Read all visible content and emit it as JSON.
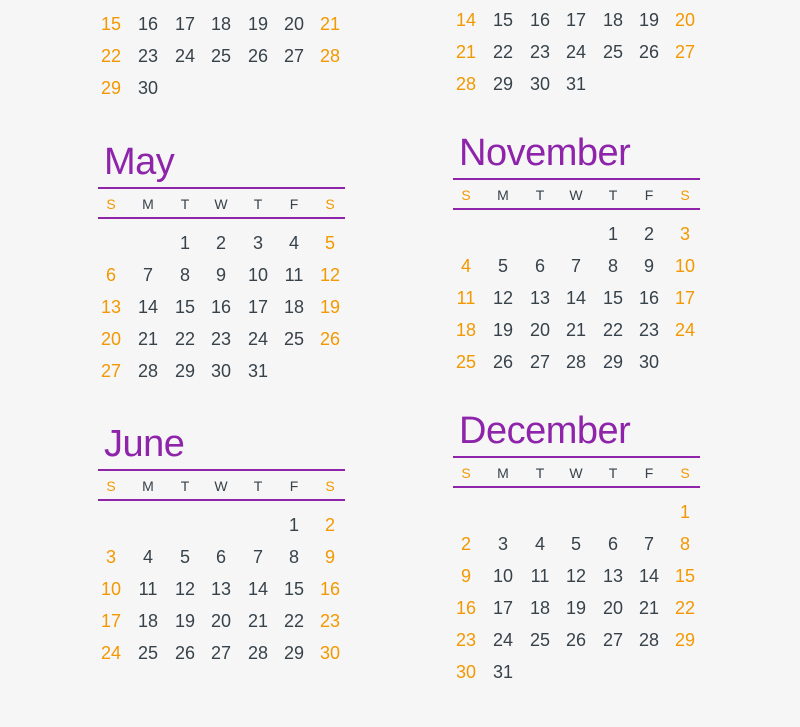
{
  "colors": {
    "title": "#8e24aa",
    "weekend": "#f39800",
    "text": "#37424a"
  },
  "weekday_headers": [
    "S",
    "M",
    "T",
    "W",
    "T",
    "F",
    "S"
  ],
  "calendars": [
    {
      "id": "partial-left",
      "title": "",
      "weeks": [
        [
          15,
          16,
          17,
          18,
          19,
          20,
          21
        ],
        [
          22,
          23,
          24,
          25,
          26,
          27,
          28
        ],
        [
          29,
          30,
          null,
          null,
          null,
          null,
          null
        ]
      ]
    },
    {
      "id": "partial-right",
      "title": "",
      "weeks": [
        [
          14,
          15,
          16,
          17,
          18,
          19,
          20
        ],
        [
          21,
          22,
          23,
          24,
          25,
          26,
          27
        ],
        [
          28,
          29,
          30,
          31,
          null,
          null,
          null
        ]
      ]
    },
    {
      "id": "may",
      "title": "May",
      "weeks": [
        [
          null,
          null,
          1,
          2,
          3,
          4,
          5
        ],
        [
          6,
          7,
          8,
          9,
          10,
          11,
          12
        ],
        [
          13,
          14,
          15,
          16,
          17,
          18,
          19
        ],
        [
          20,
          21,
          22,
          23,
          24,
          25,
          26
        ],
        [
          27,
          28,
          29,
          30,
          31,
          null,
          null
        ]
      ]
    },
    {
      "id": "november",
      "title": "November",
      "weeks": [
        [
          null,
          null,
          null,
          null,
          1,
          2,
          3
        ],
        [
          4,
          5,
          6,
          7,
          8,
          9,
          10
        ],
        [
          11,
          12,
          13,
          14,
          15,
          16,
          17
        ],
        [
          18,
          19,
          20,
          21,
          22,
          23,
          24
        ],
        [
          25,
          26,
          27,
          28,
          29,
          30,
          null
        ]
      ]
    },
    {
      "id": "june",
      "title": "June",
      "weeks": [
        [
          null,
          null,
          null,
          null,
          null,
          1,
          2
        ],
        [
          3,
          4,
          5,
          6,
          7,
          8,
          9
        ],
        [
          10,
          11,
          12,
          13,
          14,
          15,
          16
        ],
        [
          17,
          18,
          19,
          20,
          21,
          22,
          23
        ],
        [
          24,
          25,
          26,
          27,
          28,
          29,
          30
        ]
      ]
    },
    {
      "id": "december",
      "title": "December",
      "weeks": [
        [
          null,
          null,
          null,
          null,
          null,
          null,
          1
        ],
        [
          2,
          3,
          4,
          5,
          6,
          7,
          8
        ],
        [
          9,
          10,
          11,
          12,
          13,
          14,
          15
        ],
        [
          16,
          17,
          18,
          19,
          20,
          21,
          22
        ],
        [
          23,
          24,
          25,
          26,
          27,
          28,
          29
        ],
        [
          30,
          31,
          null,
          null,
          null,
          null,
          null
        ]
      ]
    }
  ]
}
